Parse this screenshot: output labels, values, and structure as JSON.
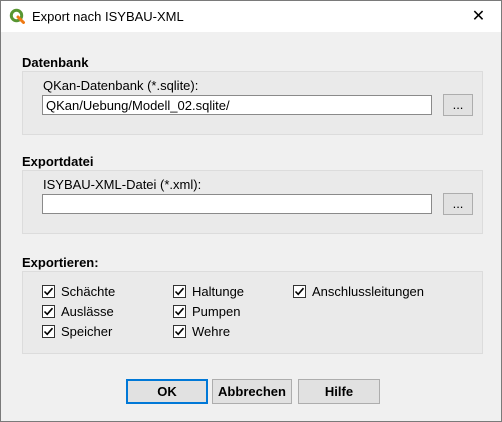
{
  "window": {
    "title": "Export nach ISYBAU-XML",
    "close_glyph": "✕",
    "icon": "qgis-logo-icon"
  },
  "datenbank": {
    "section_title": "Datenbank",
    "field_label": "QKan-Datenbank (*.sqlite):",
    "value": "/QKan/Uebung/Modell_02.sqlite",
    "browse_label": "..."
  },
  "exportdatei": {
    "section_title": "Exportdatei",
    "field_label": "ISYBAU-XML-Datei (*.xml):",
    "value": "",
    "browse_label": "..."
  },
  "exportieren": {
    "section_title": "Exportieren:",
    "options": [
      {
        "label": "Schächte",
        "checked": true
      },
      {
        "label": "Auslässe",
        "checked": true
      },
      {
        "label": "Speicher",
        "checked": true
      },
      {
        "label": "Haltunge",
        "checked": true
      },
      {
        "label": "Pumpen",
        "checked": true
      },
      {
        "label": "Wehre",
        "checked": true
      },
      {
        "label": "Anschlussleitungen",
        "checked": true
      }
    ]
  },
  "buttons": {
    "ok": "OK",
    "cancel": "Abbrechen",
    "help": "Hilfe"
  },
  "colors": {
    "accent": "#0078d7",
    "qgis_green": "#589632",
    "qgis_yellow": "#ee7913"
  }
}
